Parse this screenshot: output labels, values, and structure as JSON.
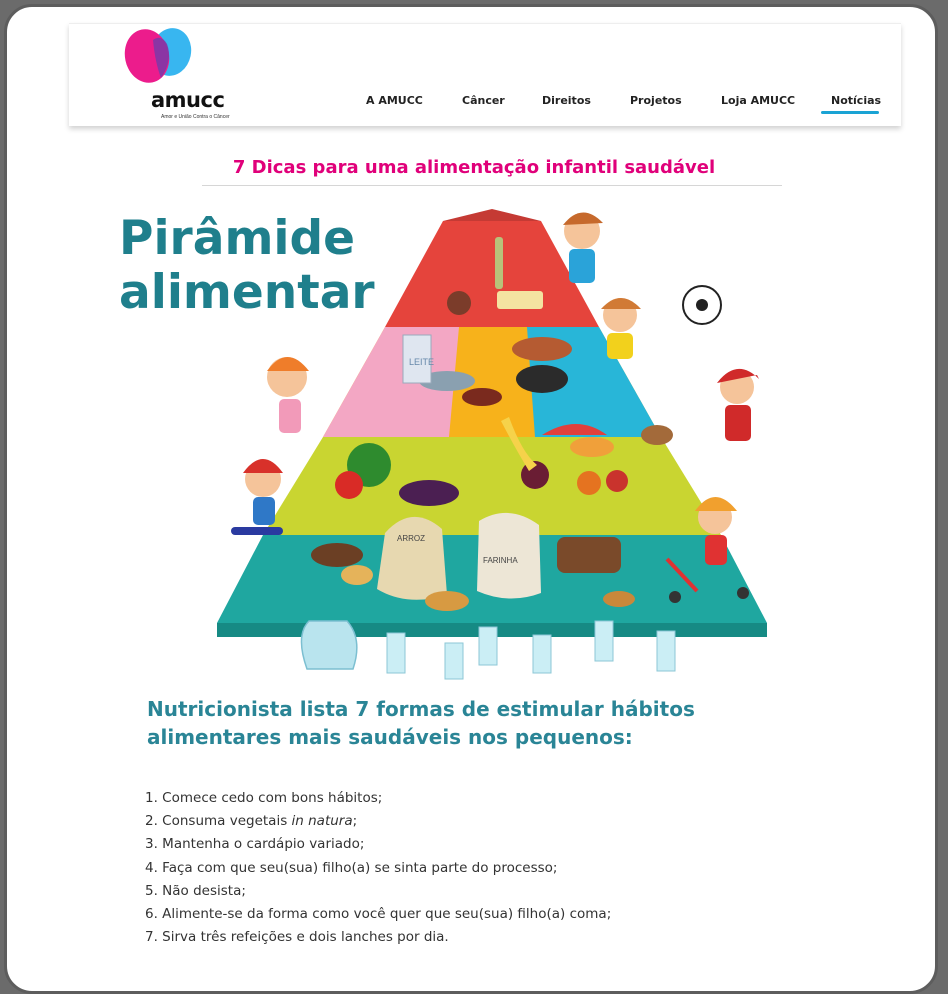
{
  "logo": {
    "word": "amucc",
    "tagline": "Amor e União Contra o Câncer"
  },
  "nav": {
    "items": [
      "A AMUCC",
      "Câncer",
      "Direitos",
      "Projetos",
      "Loja AMUCC",
      "Notícias"
    ],
    "active": "Notícias"
  },
  "article": {
    "title": "7 Dicas para uma alimentação infantil saudável",
    "hero": {
      "title_line1": "Pirâmide",
      "title_line2": "alimentar",
      "milk_label": "LEITE",
      "rice_label": "ARROZ",
      "flour_label": "FARINHA"
    },
    "subheading": "Nutricionista lista 7 formas de estimular hábitos alimentares mais saudáveis nos pequenos:",
    "tips": [
      "1. Comece cedo com bons hábitos;",
      {
        "before": "2. Consuma vegetais ",
        "italic": "in natura",
        "after": ";"
      },
      "3. Mantenha o cardápio variado;",
      "4. Faça com que seu(sua) filho(a) se sinta parte do processo;",
      "5. Não desista;",
      "6. Alimente-se da forma como você quer que seu(sua) filho(a) coma;",
      "7. Sirva três refeições e dois lanches por dia."
    ]
  },
  "colors": {
    "brand_pink": "#e0007a",
    "brand_blue": "#1aa3d4",
    "teal": "#1f7f8c",
    "frame": "#5d5d5d"
  }
}
